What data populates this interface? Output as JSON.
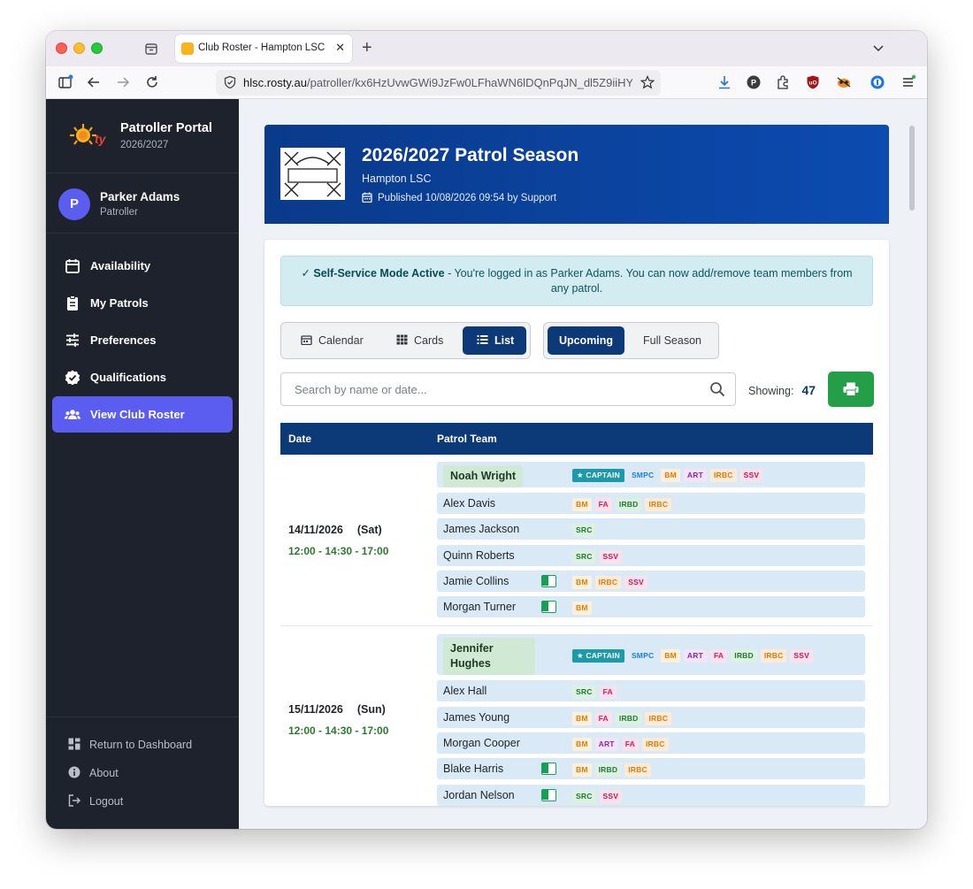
{
  "browser": {
    "tab_title": "Club Roster - Hampton LSC",
    "url_host": "hlsc.rosty.au",
    "url_path": "/patroller/kx6HzUvwGWi9JzFw0LFhaWN6lDQnPqJN_dl5Z9iiHY"
  },
  "sidebar": {
    "brand_title": "Patroller Portal",
    "brand_season": "2026/2027",
    "user_initial": "P",
    "user_name": "Parker Adams",
    "user_role": "Patroller",
    "nav": [
      {
        "label": "Availability",
        "icon": "calendar-icon"
      },
      {
        "label": "My Patrols",
        "icon": "clipboard-icon"
      },
      {
        "label": "Preferences",
        "icon": "sliders-icon"
      },
      {
        "label": "Qualifications",
        "icon": "badge-check-icon"
      },
      {
        "label": "View Club Roster",
        "icon": "users-icon",
        "active": true
      }
    ],
    "footer": [
      {
        "label": "Return to Dashboard",
        "icon": "dashboard-icon"
      },
      {
        "label": "About",
        "icon": "info-icon"
      },
      {
        "label": "Logout",
        "icon": "logout-icon"
      }
    ]
  },
  "header": {
    "title": "2026/2027 Patrol Season",
    "club": "Hampton LSC",
    "published": "Published 10/08/2026 09:54 by Support"
  },
  "alert": {
    "strong": "✓ Self-Service Mode Active",
    "text": " - You're logged in as Parker Adams. You can now add/remove team members from any patrol."
  },
  "view_toggle": {
    "calendar": "Calendar",
    "cards": "Cards",
    "list": "List",
    "selected": "List"
  },
  "range_toggle": {
    "upcoming": "Upcoming",
    "full": "Full Season",
    "selected": "Upcoming"
  },
  "search": {
    "placeholder": "Search by name or date..."
  },
  "showing": {
    "label": "Showing:",
    "count": "47"
  },
  "table": {
    "col_date": "Date",
    "col_team": "Patrol Team"
  },
  "patrols": [
    {
      "date": "14/11/2026",
      "day": "(Sat)",
      "time": "12:00 - 14:30 - 17:00",
      "captain": {
        "name": "Noah Wright",
        "quals": [
          "★ CAPTAIN",
          "SMPC",
          "BM",
          "ART",
          "IRBC",
          "SSV"
        ]
      },
      "members": [
        {
          "name": "Alex Davis",
          "quals": [
            "BM",
            "FA",
            "IRBD",
            "IRBC"
          ],
          "toggle": false
        },
        {
          "name": "James Jackson",
          "quals": [
            "SRC"
          ],
          "toggle": false
        },
        {
          "name": "Quinn Roberts",
          "quals": [
            "SRC",
            "SSV"
          ],
          "toggle": false
        },
        {
          "name": "Jamie Collins",
          "quals": [
            "BM",
            "IRBC",
            "SSV"
          ],
          "toggle": true
        },
        {
          "name": "Morgan Turner",
          "quals": [
            "BM"
          ],
          "toggle": true
        }
      ]
    },
    {
      "date": "15/11/2026",
      "day": "(Sun)",
      "time": "12:00 - 14:30 - 17:00",
      "captain": {
        "name": "Jennifer Hughes",
        "quals": [
          "★ CAPTAIN",
          "SMPC",
          "BM",
          "ART",
          "FA",
          "IRBD",
          "IRBC",
          "SSV"
        ]
      },
      "members": [
        {
          "name": "Alex Hall",
          "quals": [
            "SRC",
            "FA"
          ],
          "toggle": false
        },
        {
          "name": "James Young",
          "quals": [
            "BM",
            "FA",
            "IRBD",
            "IRBC"
          ],
          "toggle": false
        },
        {
          "name": "Morgan Cooper",
          "quals": [
            "BM",
            "ART",
            "FA",
            "IRBC"
          ],
          "toggle": false
        },
        {
          "name": "Blake Harris",
          "quals": [
            "BM",
            "IRBD",
            "IRBC"
          ],
          "toggle": true
        },
        {
          "name": "Jordan Nelson",
          "quals": [
            "SRC",
            "SSV"
          ],
          "toggle": true
        }
      ]
    }
  ]
}
